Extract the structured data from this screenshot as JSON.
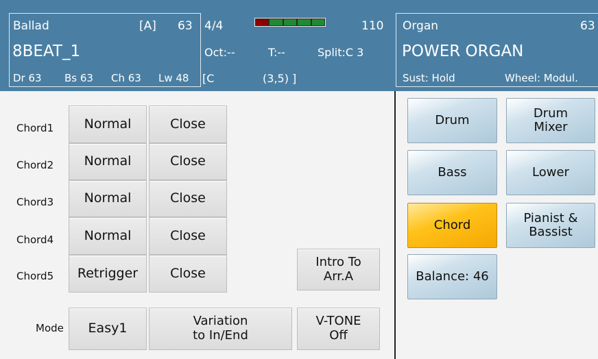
{
  "header": {
    "left": {
      "style_category": "Ballad",
      "bank": "[A]",
      "style_num": "63",
      "style_name": "8BEAT_1",
      "levels": [
        "Dr 63",
        "Bs 63",
        "Ch 63",
        "Lw 48"
      ]
    },
    "mid": {
      "time_sig": "4/4",
      "tempo": "110",
      "octave": "Oct:--",
      "transpose": "T:--",
      "split": "Split:C 3",
      "chord_left": "[C",
      "chord_right": "(3,5) ]",
      "meter_colors": [
        "#8b0000",
        "#1f8a32",
        "#1f8a32",
        "#1f8a32",
        "#1f8a32"
      ]
    },
    "right": {
      "voice_category": "Organ",
      "voice_num": "63",
      "voice_name": "POWER ORGAN",
      "sustain": "Sust: Hold",
      "wheel": "Wheel: Modul."
    }
  },
  "left_panel": {
    "rows": [
      {
        "label": "Chord1",
        "mode": "Normal",
        "voicing": "Close"
      },
      {
        "label": "Chord2",
        "mode": "Normal",
        "voicing": "Close"
      },
      {
        "label": "Chord3",
        "mode": "Normal",
        "voicing": "Close"
      },
      {
        "label": "Chord4",
        "mode": "Normal",
        "voicing": "Close"
      },
      {
        "label": "Chord5",
        "mode": "Retrigger",
        "voicing": "Close"
      }
    ],
    "intro_button": {
      "line1": "Intro To",
      "line2": "Arr.A"
    },
    "mode_label": "Mode",
    "mode_value": "Easy1",
    "variation_button": {
      "line1": "Variation",
      "line2": "to In/End"
    },
    "vtone_button": {
      "line1": "V-TONE",
      "line2": "Off"
    }
  },
  "right_panel": {
    "drum": "Drum",
    "drum_mixer": {
      "line1": "Drum",
      "line2": "Mixer"
    },
    "bass": "Bass",
    "lower": "Lower",
    "chord": "Chord",
    "pianist_bassist": {
      "line1": "Pianist &",
      "line2": "Bassist"
    },
    "balance": "Balance: 46",
    "active_color": "#ffc21a"
  }
}
